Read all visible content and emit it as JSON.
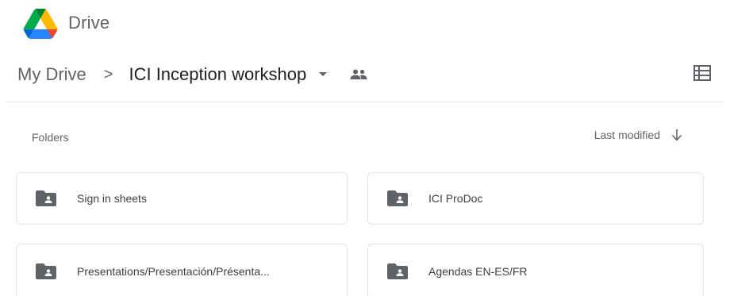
{
  "app": {
    "name": "Drive"
  },
  "breadcrumb": {
    "root": "My Drive",
    "separator": ">",
    "current": "ICI Inception workshop"
  },
  "section": {
    "label": "Folders"
  },
  "sort": {
    "label": "Last modified"
  },
  "folders": [
    {
      "label": "Sign in sheets"
    },
    {
      "label": "ICI ProDoc"
    },
    {
      "label": "Presentations/Presentación/Présenta..."
    },
    {
      "label": "Agendas EN-ES/FR"
    }
  ],
  "colors": {
    "drive_green": "#1e8e3e",
    "drive_blue": "#1967d2",
    "drive_yellow": "#fbbc04",
    "drive_red": "#ea4335",
    "icon_gray": "#5f6368"
  },
  "icons": {
    "logo": "google-drive-logo",
    "view": "list-view-icon",
    "shared": "shared-people-icon",
    "folder": "shared-folder-icon",
    "sort": "arrow-down-icon"
  }
}
